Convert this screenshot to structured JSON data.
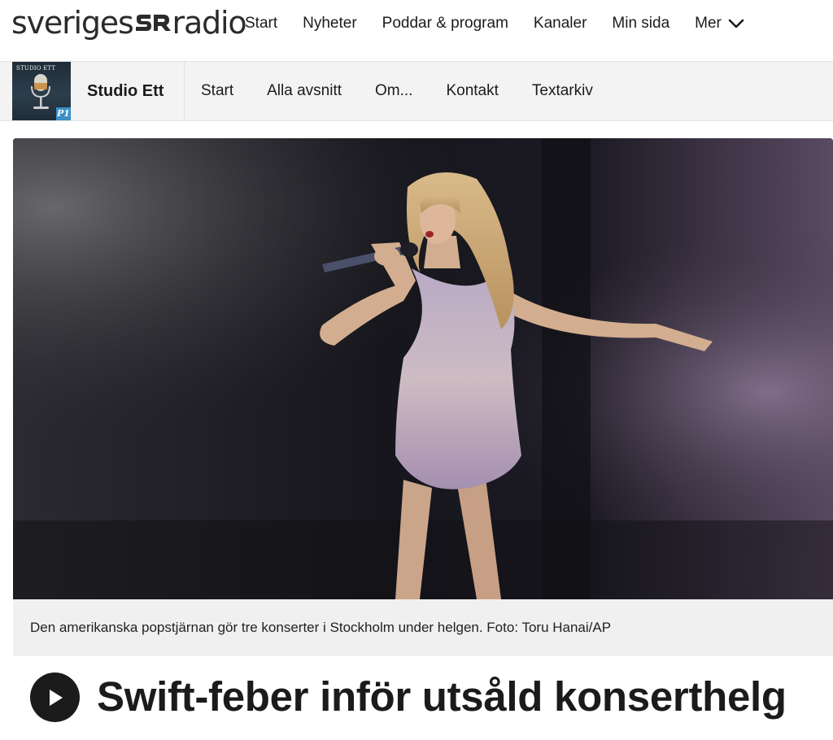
{
  "site": {
    "logo_left": "sveriges",
    "logo_mark": "SR",
    "logo_right": "radio"
  },
  "top_nav": {
    "items": [
      "Start",
      "Nyheter",
      "Poddar & program",
      "Kanaler",
      "Min sida"
    ],
    "more_label": "Mer"
  },
  "program": {
    "thumb_title": "STUDIO ETT",
    "thumb_badge": "P1",
    "title": "Studio Ett",
    "nav": [
      "Start",
      "Alla avsnitt",
      "Om...",
      "Kontakt",
      "Textarkiv"
    ]
  },
  "hero": {
    "image_caption": "Den amerikanska popstjärnan gör tre konserter i Stockholm under helgen. Foto: Toru Hanai/AP"
  },
  "article": {
    "headline": "Swift-feber inför utsåld konserthelg"
  },
  "colors": {
    "text": "#1b1b1b",
    "program_bar_bg": "#f3f3f3",
    "caption_bg": "#f0f0f0",
    "badge_blue": "#3a8fc9"
  }
}
